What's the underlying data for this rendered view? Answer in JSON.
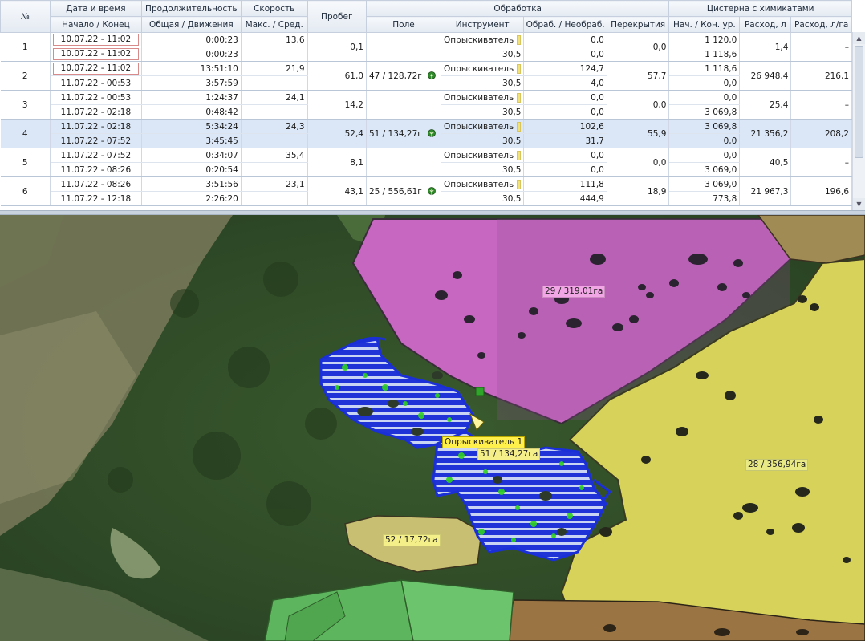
{
  "header": {
    "num": "№",
    "datetime": "Дата и время",
    "datetime_sub": "Начало / Конец",
    "duration": "Продолжительность",
    "duration_sub": "Общая / Движения",
    "speed": "Скорость",
    "speed_sub": "Макс. / Сред.",
    "mileage": "Пробег",
    "processing": "Обработка",
    "field": "Поле",
    "tool": "Инструмент",
    "processed": "Обраб. / Необраб.",
    "overlap": "Перекрытия",
    "tank": "Цистерна с химикатами",
    "tank_level": "Нач. / Кон. ур.",
    "consumption": "Расход, л",
    "consumption_rate": "Расход, л/га"
  },
  "rows": [
    {
      "n": "1",
      "start": "10.07.22 - 11:02",
      "end": "10.07.22 - 11:02",
      "total": "0:00:23",
      "moving": "0:00:23",
      "vmax": "13,6",
      "mileage": "0,1",
      "field": "",
      "tool": "Опрыскиватель",
      "width": "30,5",
      "proc": "0,0",
      "unproc": "0,0",
      "overlap": "0,0",
      "lvl_start": "1 120,0",
      "lvl_end": "1 118,6",
      "cons": "1,4",
      "rate": "–"
    },
    {
      "n": "2",
      "start": "10.07.22 - 11:02",
      "end": "11.07.22 - 00:53",
      "total": "13:51:10",
      "moving": "3:57:59",
      "vmax": "21,9",
      "mileage": "61,0",
      "field": "47 / 128,72г",
      "tool": "Опрыскиватель",
      "width": "30,5",
      "proc": "124,7",
      "unproc": "4,0",
      "overlap": "57,7",
      "lvl_start": "1 118,6",
      "lvl_end": "0,0",
      "cons": "26 948,4",
      "rate": "216,1"
    },
    {
      "n": "3",
      "start": "11.07.22 - 00:53",
      "end": "11.07.22 - 02:18",
      "total": "1:24:37",
      "moving": "0:48:42",
      "vmax": "24,1",
      "mileage": "14,2",
      "field": "",
      "tool": "Опрыскиватель",
      "width": "30,5",
      "proc": "0,0",
      "unproc": "0,0",
      "overlap": "0,0",
      "lvl_start": "0,0",
      "lvl_end": "3 069,8",
      "cons": "25,4",
      "rate": "–"
    },
    {
      "n": "4",
      "start": "11.07.22 - 02:18",
      "end": "11.07.22 - 07:52",
      "total": "5:34:24",
      "moving": "3:45:45",
      "vmax": "24,3",
      "mileage": "52,4",
      "field": "51 / 134,27г",
      "tool": "Опрыскиватель",
      "width": "30,5",
      "proc": "102,6",
      "unproc": "31,7",
      "overlap": "55,9",
      "lvl_start": "3 069,8",
      "lvl_end": "0,0",
      "cons": "21 356,2",
      "rate": "208,2"
    },
    {
      "n": "5",
      "start": "11.07.22 - 07:52",
      "end": "11.07.22 - 08:26",
      "total": "0:34:07",
      "moving": "0:20:54",
      "vmax": "35,4",
      "mileage": "8,1",
      "field": "",
      "tool": "Опрыскиватель",
      "width": "30,5",
      "proc": "0,0",
      "unproc": "0,0",
      "overlap": "0,0",
      "lvl_start": "0,0",
      "lvl_end": "3 069,0",
      "cons": "40,5",
      "rate": "–"
    },
    {
      "n": "6",
      "start": "11.07.22 - 08:26",
      "end": "11.07.22 - 12:18",
      "total": "3:51:56",
      "moving": "2:26:20",
      "vmax": "23,1",
      "mileage": "43,1",
      "field": "25 / 556,61г",
      "tool": "Опрыскиватель",
      "width": "30,5",
      "proc": "111,8",
      "unproc": "444,9",
      "overlap": "18,9",
      "lvl_start": "3 069,0",
      "lvl_end": "773,8",
      "cons": "21 967,3",
      "rate": "196,6"
    }
  ],
  "map": {
    "field_29": "29 / 319,01га",
    "field_28": "28 / 356,94га",
    "field_51": "51 / 134,27га",
    "field_52": "52 / 17,72га",
    "vehicle": "Опрыскиватель 1",
    "vehicle_icon": "arrow-marker-icon"
  },
  "colors": {
    "selected_row": "#dbe7f6",
    "field_pink": "#c767c2",
    "field_yellow": "#d7d35a",
    "track_blue": "#1a2fd8",
    "track_green": "#2fd21f"
  }
}
